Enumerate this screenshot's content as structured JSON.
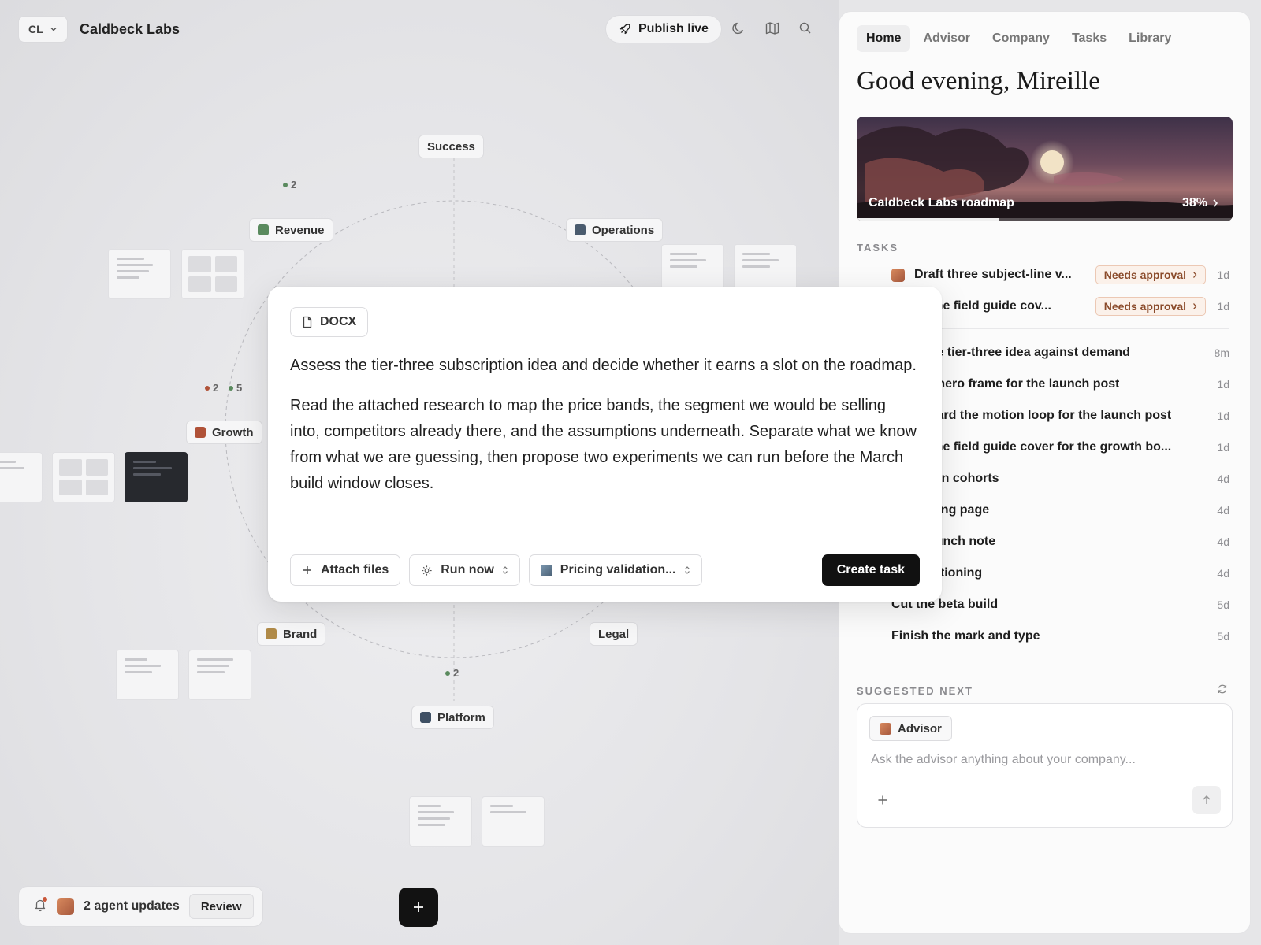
{
  "topbar": {
    "org_initials": "CL",
    "org_name": "Caldbeck Labs",
    "publish_label": "Publish live"
  },
  "orbit": {
    "nodes": [
      {
        "label": "Success",
        "color": ""
      },
      {
        "label": "Revenue",
        "color": "#5a8a5e"
      },
      {
        "label": "Operations",
        "color": "#4a5b6e"
      },
      {
        "label": "Growth",
        "color": "#b05238"
      },
      {
        "label": "Brand",
        "color": "#b08a48"
      },
      {
        "label": "Legal",
        "color": ""
      },
      {
        "label": "Platform",
        "color": "#3f5064"
      }
    ],
    "counts": [
      {
        "value": "2",
        "color": "#5a8a5e"
      },
      {
        "value": "2",
        "color": "#b05238"
      },
      {
        "value": "5",
        "color": "#5a8a5e"
      },
      {
        "value": "2",
        "color": "#5a8a5e"
      }
    ]
  },
  "bottom": {
    "updates_text": "2 agent updates",
    "review_label": "Review"
  },
  "modal": {
    "file_type": "DOCX",
    "paragraph_1": "Assess the tier-three subscription idea and decide whether it earns a slot on the roadmap.",
    "paragraph_2": "Read the attached research to map the price bands, the segment we would be selling into, competitors already there, and the assumptions underneath. Separate what we know from what we are guessing, then propose two experiments we can run before the March build window closes.",
    "attach_label": "Attach files",
    "run_label": "Run now",
    "project_label": "Pricing validation...",
    "create_label": "Create task"
  },
  "panel": {
    "tabs": [
      "Home",
      "Advisor",
      "Company",
      "Tasks",
      "Library"
    ],
    "active_tab": "Home",
    "greeting": "Good evening, Mireille",
    "hero": {
      "title": "Caldbeck Labs roadmap",
      "progress_percent": 38,
      "progress_label": "38%"
    },
    "tasks_heading": "TASKS",
    "approval_tasks": [
      {
        "title": "Draft three subject-line v...",
        "badge": "Needs approval",
        "age": "1d"
      },
      {
        "title": "ze the field guide cov...",
        "badge": "Needs approval",
        "age": "1d"
      }
    ],
    "tasks": [
      {
        "title": "e the tier-three idea against demand",
        "age": "8m"
      },
      {
        "title": "rt a hero frame for the launch post",
        "age": "1d"
      },
      {
        "title": "yboard the motion loop for the launch post",
        "age": "1d"
      },
      {
        "title": "ze the field guide cover for the growth bo...",
        "age": "1d"
      },
      {
        "title": "churn cohorts",
        "age": "4d"
      },
      {
        "title": "pricing page",
        "age": "4d"
      },
      {
        "title": "e launch note",
        "age": "4d"
      },
      {
        "title": "positioning",
        "age": "4d"
      },
      {
        "title": "Cut the beta build",
        "age": "5d"
      },
      {
        "title": "Finish the mark and type",
        "age": "5d"
      }
    ],
    "suggested_heading": "SUGGESTED NEXT",
    "advisor_chip": "Advisor",
    "ask_placeholder": "Ask the advisor anything about your company..."
  }
}
